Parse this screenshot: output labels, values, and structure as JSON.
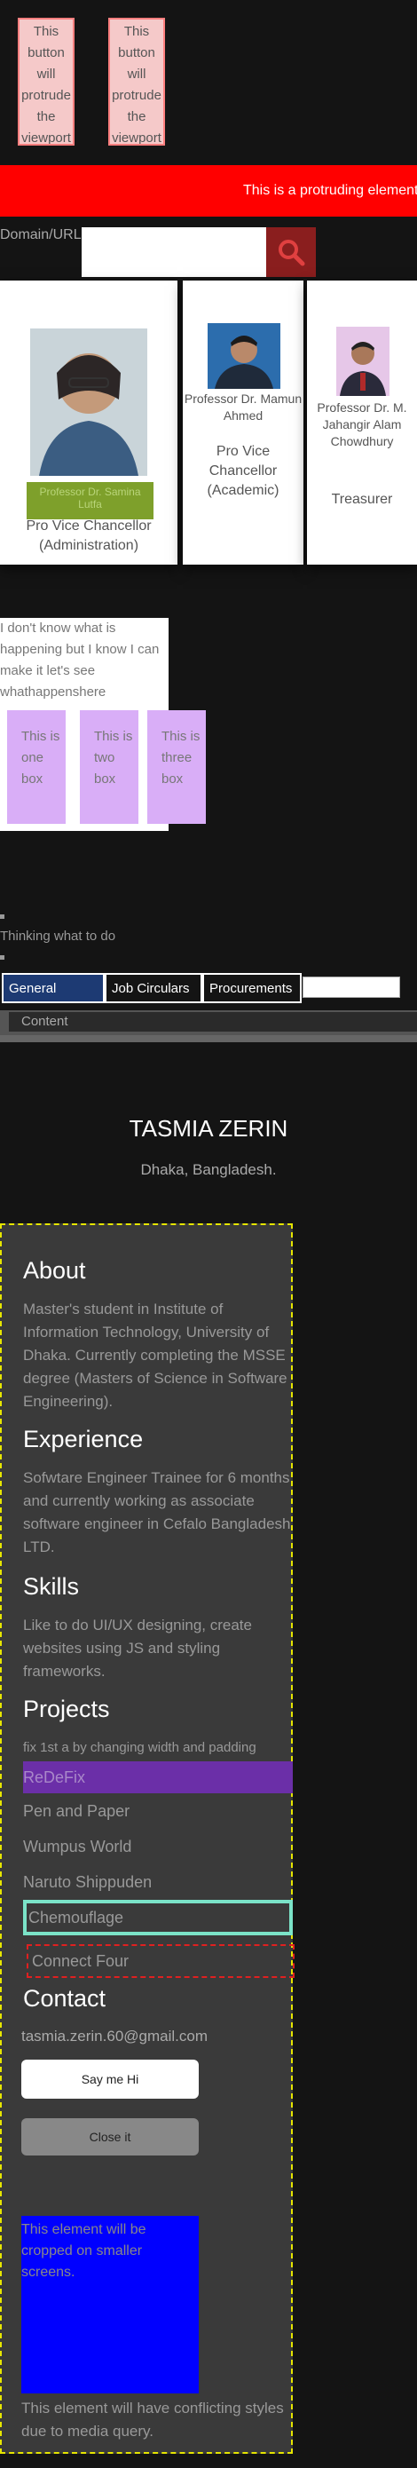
{
  "protrude_buttons": [
    "This button will protrude the viewport",
    "This button will protrude the viewport"
  ],
  "protruding_banner": "This is a protruding element",
  "domain": {
    "label": "Domain/URL",
    "placeholder": ""
  },
  "cards": [
    {
      "name": "",
      "role": "Pro Vice Chancellor (Administration)",
      "badge": "Professor Dr. Samina Lutfa"
    },
    {
      "name": "Professor Dr. Mamun Ahmed",
      "role": "Pro Vice Chancellor (Academic)"
    },
    {
      "name": "Professor Dr. M. Jahangir Alam Chowdhury",
      "role": "Treasurer"
    }
  ],
  "info_text": "I don't know what is happening but I know I can make it let's see whathappenshere",
  "boxes": [
    "This is one box",
    "This is two box",
    "This is three box"
  ],
  "thinking": "Thinking what to do",
  "tabs": [
    "General Notice",
    "Job Circulars",
    "Procurements"
  ],
  "content_label": "Content",
  "profile": {
    "name": "TASMIA ZERIN",
    "location": "Dhaka, Bangladesh.",
    "about_heading": "About",
    "about_text": "Master's student in Institute of Information Technology, University of Dhaka. Currently completing the MSSE degree (Masters of Science in Software Engineering).",
    "experience_heading": "Experience",
    "experience_text": "Sofwtare Engineer Trainee for 6 months and currently working as associate software engineer in Cefalo Bangladesh LTD.",
    "skills_heading": "Skills",
    "skills_text": "Like to do UI/UX designing, create websites using JS and styling frameworks.",
    "projects_heading": "Projects",
    "projects_note": "fix 1st a by changing width and padding",
    "projects": [
      "ReDeFix",
      "Pen and Paper",
      "Wumpus World",
      "Naruto Shippuden",
      "Chemouflage",
      "Connect Four"
    ],
    "contact_heading": "Contact",
    "email": "tasmia.zerin.60@gmail.com",
    "say_hi": "Say me Hi",
    "close": "Close it",
    "blue_box_text": "This element will be cropped on smaller screens.",
    "footer_note": "This element will have conflicting styles due to media query."
  },
  "colors": {
    "banner": "#ff0000",
    "tab_active": "#1d3a73",
    "panel_border": "#e6e600",
    "project_highlight": "#6b2fa8",
    "blue_box": "#0000ff"
  }
}
